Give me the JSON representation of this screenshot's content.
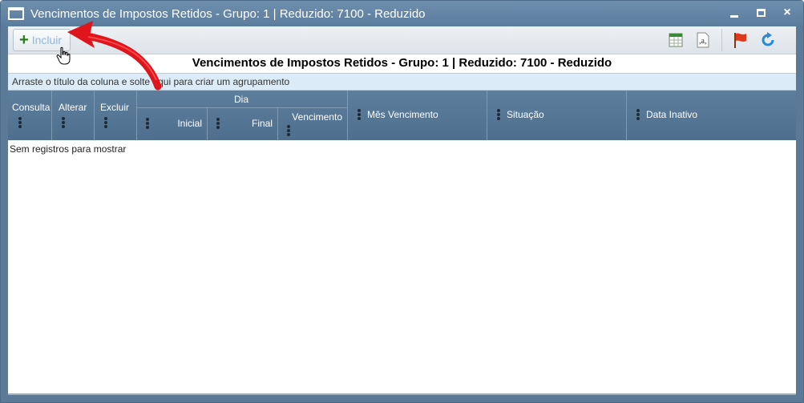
{
  "window": {
    "title": "Vencimentos de Impostos Retidos - Grupo: 1 | Reduzido: 7100 - Reduzido",
    "controls": {
      "minimize": "minimize-icon",
      "maximize": "maximize-icon",
      "close": "×"
    }
  },
  "toolbar": {
    "incluir_label": "Incluir",
    "incluir_icon": "plus-icon",
    "tools": [
      "excel-export-icon",
      "spellcheck-icon",
      "flag-icon",
      "refresh-icon"
    ]
  },
  "report": {
    "title": "Vencimentos de Impostos Retidos - Grupo: 1 | Reduzido: 7100 - Reduzido"
  },
  "group_bar": {
    "text": "Arraste o título da coluna e solte aqui para criar um agrupamento"
  },
  "columns": {
    "consulta": "Consulta",
    "alterar": "Alterar",
    "excluir": "Excluir",
    "dia_group": "Dia",
    "inicial": "Inicial",
    "final": "Final",
    "vencimento": "Vencimento",
    "mes_vencimento": "Mês Vencimento",
    "situacao": "Situação",
    "data_inativo": "Data Inativo"
  },
  "grid": {
    "empty_message": "Sem registros para mostrar"
  },
  "colors": {
    "titlebar": "#5b7c9c",
    "header": "#4e6f8e",
    "group_bar": "#dcebf8",
    "annotation_arrow": "#e0141b"
  }
}
